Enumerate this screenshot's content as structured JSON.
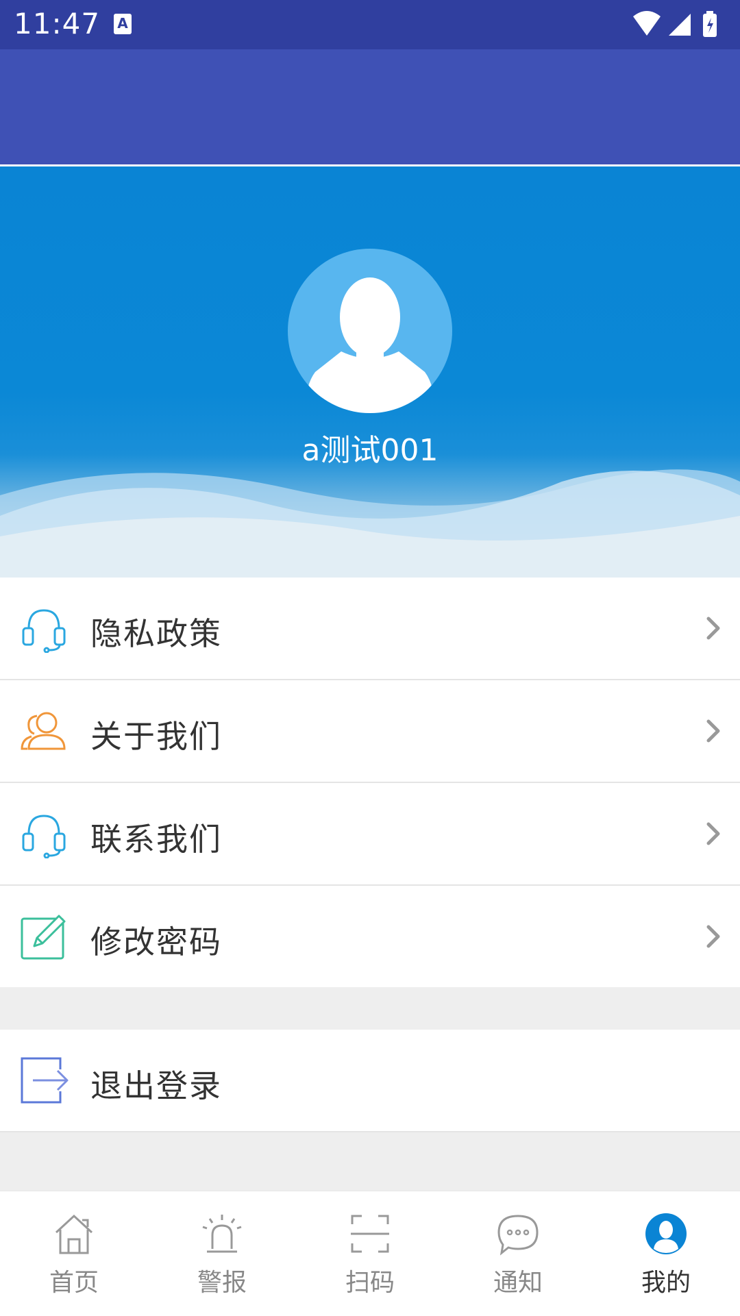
{
  "status_bar": {
    "time": "11:47",
    "notification_icon": "A"
  },
  "profile": {
    "username": "a测试001"
  },
  "menu": [
    {
      "label": "隐私政策",
      "icon": "headset-icon",
      "color": "#2aa7e0"
    },
    {
      "label": "关于我们",
      "icon": "users-icon",
      "color": "#f0963a"
    },
    {
      "label": "联系我们",
      "icon": "headset-icon",
      "color": "#2aa7e0"
    },
    {
      "label": "修改密码",
      "icon": "edit-icon",
      "color": "#3bbf9b"
    }
  ],
  "logout": {
    "label": "退出登录",
    "icon": "logout-icon",
    "color": "#5b78d8"
  },
  "bottom_nav": [
    {
      "label": "首页",
      "icon": "home-icon"
    },
    {
      "label": "警报",
      "icon": "alarm-icon"
    },
    {
      "label": "扫码",
      "icon": "scan-icon"
    },
    {
      "label": "通知",
      "icon": "message-icon"
    },
    {
      "label": "我的",
      "icon": "profile-icon",
      "active": true
    }
  ],
  "colors": {
    "status_bar": "#303f9f",
    "toolbar": "#3f51b5",
    "header_blue": "#0a84d4",
    "active_tab": "#0a84d4"
  }
}
